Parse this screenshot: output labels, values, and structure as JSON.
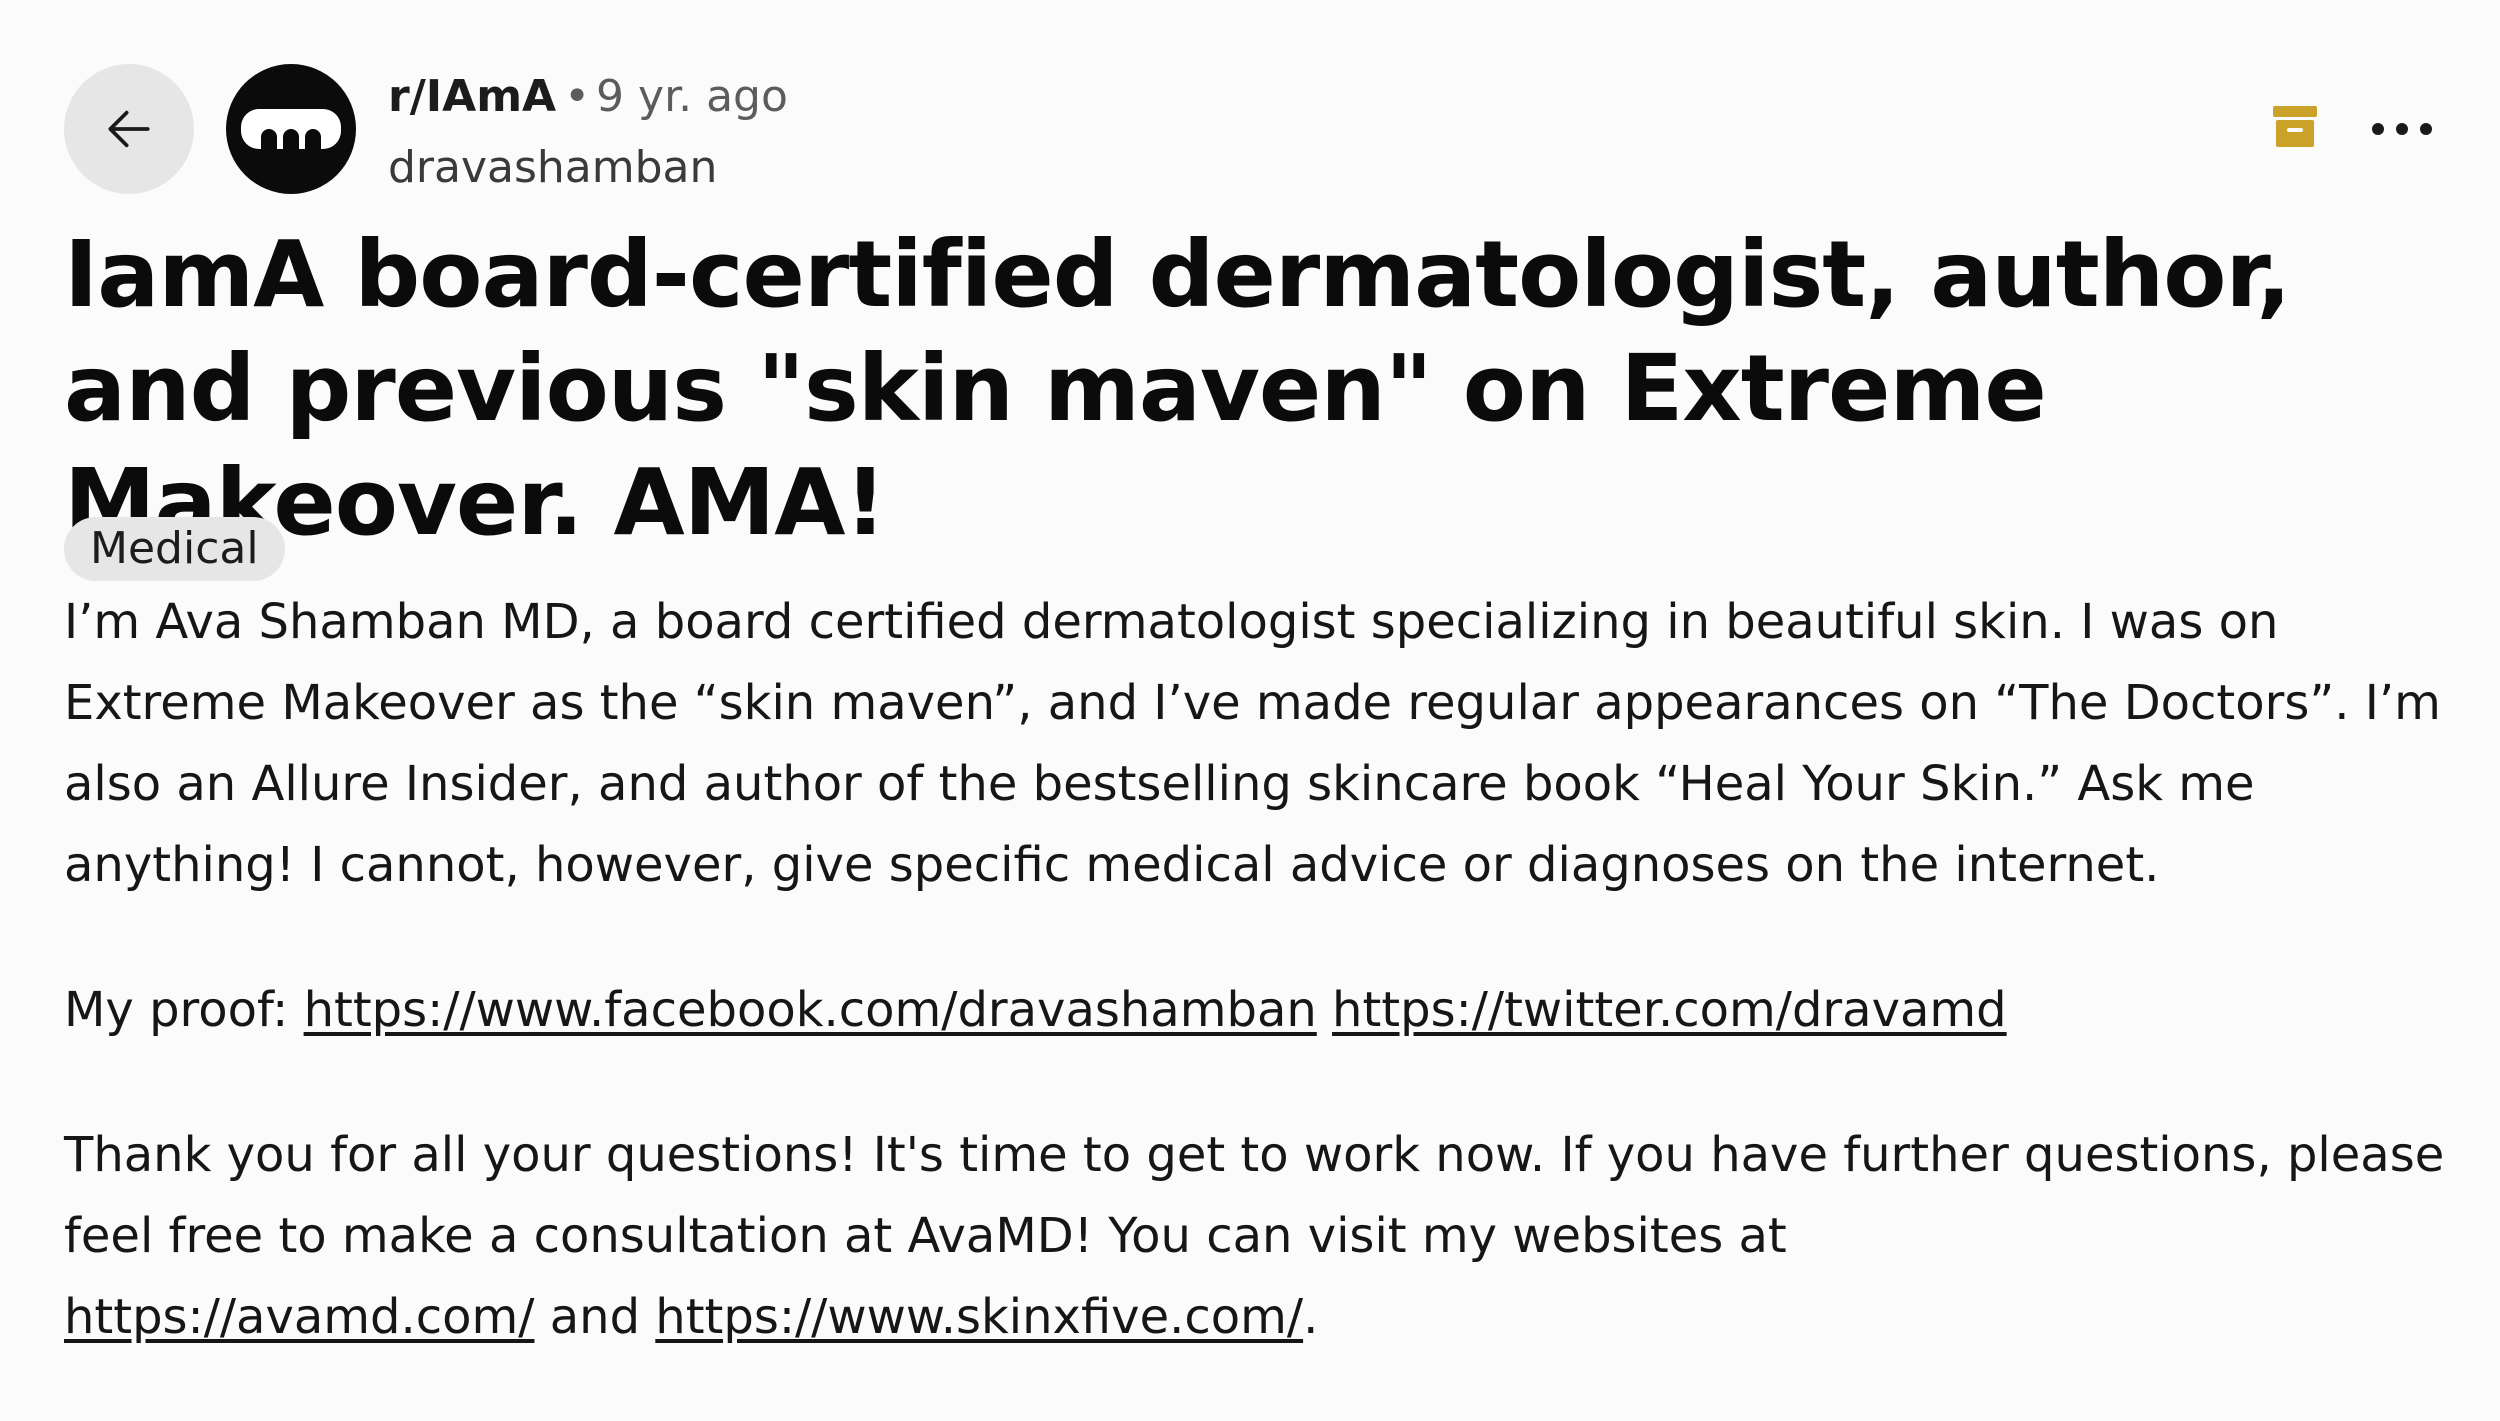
{
  "header": {
    "subreddit": "r/IAmA",
    "separator": "•",
    "time_ago": "9 yr. ago",
    "author": "dravashamban"
  },
  "post": {
    "title": "IamA board-certified dermatologist, author, and previous \"skin maven\" on Extreme Makeover. AMA!",
    "flair": "Medical",
    "paragraph1": "I’m Ava Shamban MD, a board certified dermatologist specializing in beautiful skin. I was on Extreme Makeover as the “skin maven”, and I’ve made regular appearances on “The Doctors”. I’m also an Allure Insider, and author of the bestselling skincare book “Heal Your Skin.” Ask me anything! I cannot, however, give specific medical advice or diagnoses on the internet.",
    "proof_label": "My proof: ",
    "proof_link_facebook": "https://www.facebook.com/dravashamban",
    "proof_link_twitter": "https://twitter.com/dravamd",
    "closing_text": "Thank you for all your questions! It's time to get to work now. If you have further questions, please feel free to make a consultation at AvaMD! You can visit my websites at ",
    "closing_link_avamd": "https://avamd.com/",
    "closing_and": " and ",
    "closing_link_skinxfive": "https://www.skinxfive.com/",
    "closing_period": "."
  },
  "icons": {
    "back": "arrow-left-icon",
    "avatar": "subreddit-logo-icon",
    "archive": "archive-icon",
    "more": "more-options-icon"
  },
  "colors": {
    "archive_icon": "#c9a227",
    "flair_bg": "#e6e6e6",
    "back_button_bg": "#e6e6e6"
  }
}
